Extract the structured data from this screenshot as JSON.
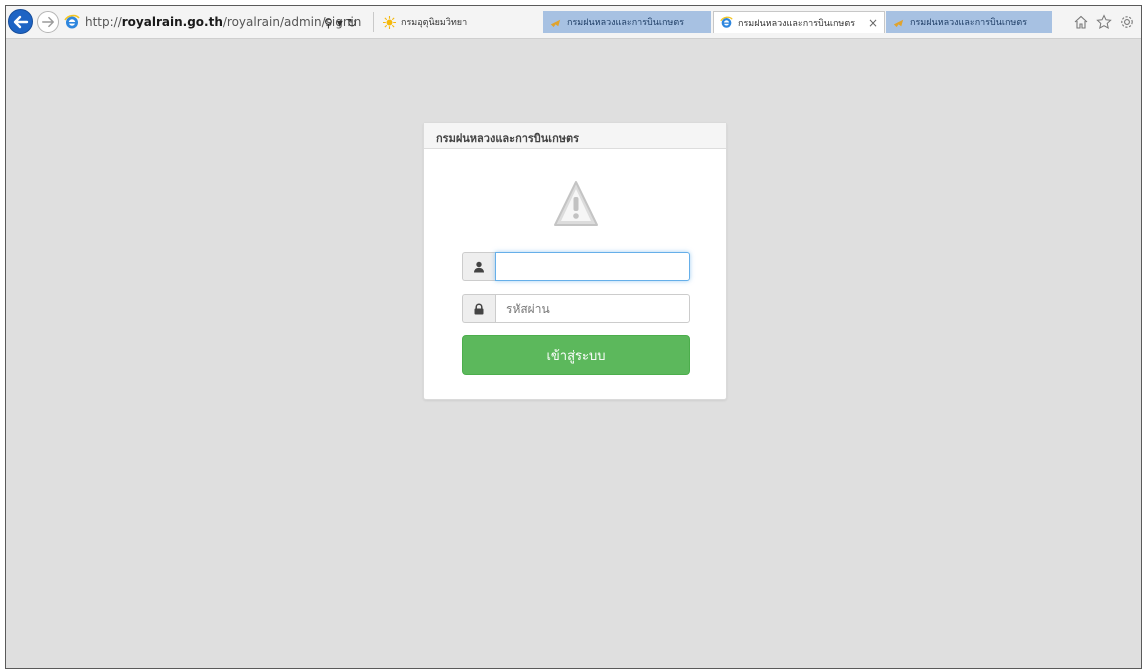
{
  "browser": {
    "url_prefix": "http://",
    "url_domain": "royalrain.go.th",
    "url_path": "/royalrain/admin/signin",
    "search_glyph": "⚲",
    "dropdown_glyph": "▾",
    "refresh_glyph": "↻",
    "tabs": [
      {
        "label": "กรมอุตุนิยมวิทยา",
        "active": false
      },
      {
        "label": "กรมฝนหลวงและการบินเกษตร",
        "active": false
      },
      {
        "label": "กรมฝนหลวงและการบินเกษตร",
        "active": true,
        "close": "×"
      },
      {
        "label": "กรมฝนหลวงและการบินเกษตร",
        "active": false
      }
    ]
  },
  "panel": {
    "title": "กรมฝนหลวงและการบินเกษตร",
    "username": {
      "value": "",
      "placeholder": ""
    },
    "password": {
      "value": "",
      "placeholder": "รหัสผ่าน"
    },
    "login_label": "เข้าสู่ระบบ"
  },
  "colors": {
    "page_bg": "#dfdfdf",
    "button": "#5cb85c",
    "focus": "#66afe9",
    "tab_inactive": "#a7c1e2"
  },
  "icons": {
    "back": "arrow-left-icon",
    "forward": "arrow-right-icon",
    "home": "home-icon",
    "favorites": "star-icon",
    "settings": "gear-icon",
    "warning": "warning-icon",
    "user": "user-icon",
    "lock": "lock-icon"
  }
}
